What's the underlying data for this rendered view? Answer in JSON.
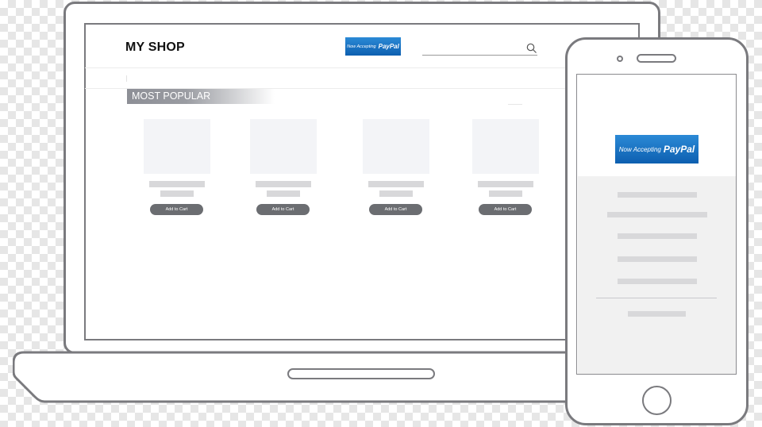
{
  "shop": {
    "title": "MY SHOP",
    "section_title": "MOST POPULAR",
    "search": {
      "placeholder": ""
    }
  },
  "paypal_badge": {
    "accepting_text": "Now Accepting",
    "brand_text": "PayPal"
  },
  "products": [
    {
      "cart_label": "Add to Cart"
    },
    {
      "cart_label": "Add to Cart"
    },
    {
      "cart_label": "Add to Cart"
    },
    {
      "cart_label": "Add to Cart"
    }
  ],
  "icons": {
    "search": "search-icon",
    "home": "home-button"
  },
  "colors": {
    "paypal_blue": "#0d5fb0",
    "button_gray": "#6b6d71",
    "section_bar": "#8d8f96",
    "frame_gray": "#7a7a7e"
  }
}
